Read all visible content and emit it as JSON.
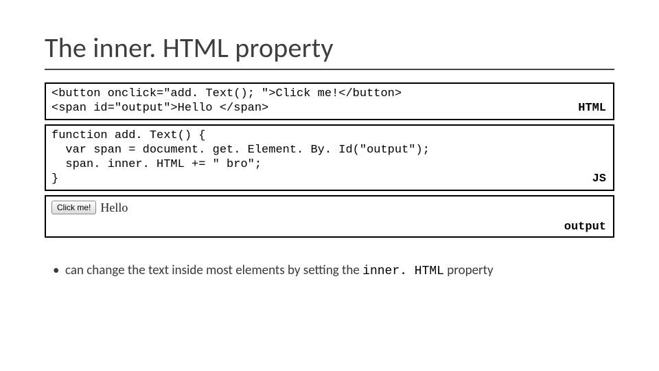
{
  "title": "The inner. HTML property",
  "boxes": {
    "html": {
      "code": "<button onclick=\"add. Text(); \">Click me!</button>\n<span id=\"output\">Hello </span>",
      "label": "HTML"
    },
    "js": {
      "code": "function add. Text() {\n  var span = document. get. Element. By. Id(\"output\");\n  span. inner. HTML += \" bro\";\n}",
      "label": "JS"
    },
    "output": {
      "button_text": "Click me!",
      "display_text": "Hello",
      "label": "output"
    }
  },
  "bullet": {
    "pre": "can change the text inside most elements by setting the ",
    "code": "inner. HTML",
    "post": " property"
  }
}
